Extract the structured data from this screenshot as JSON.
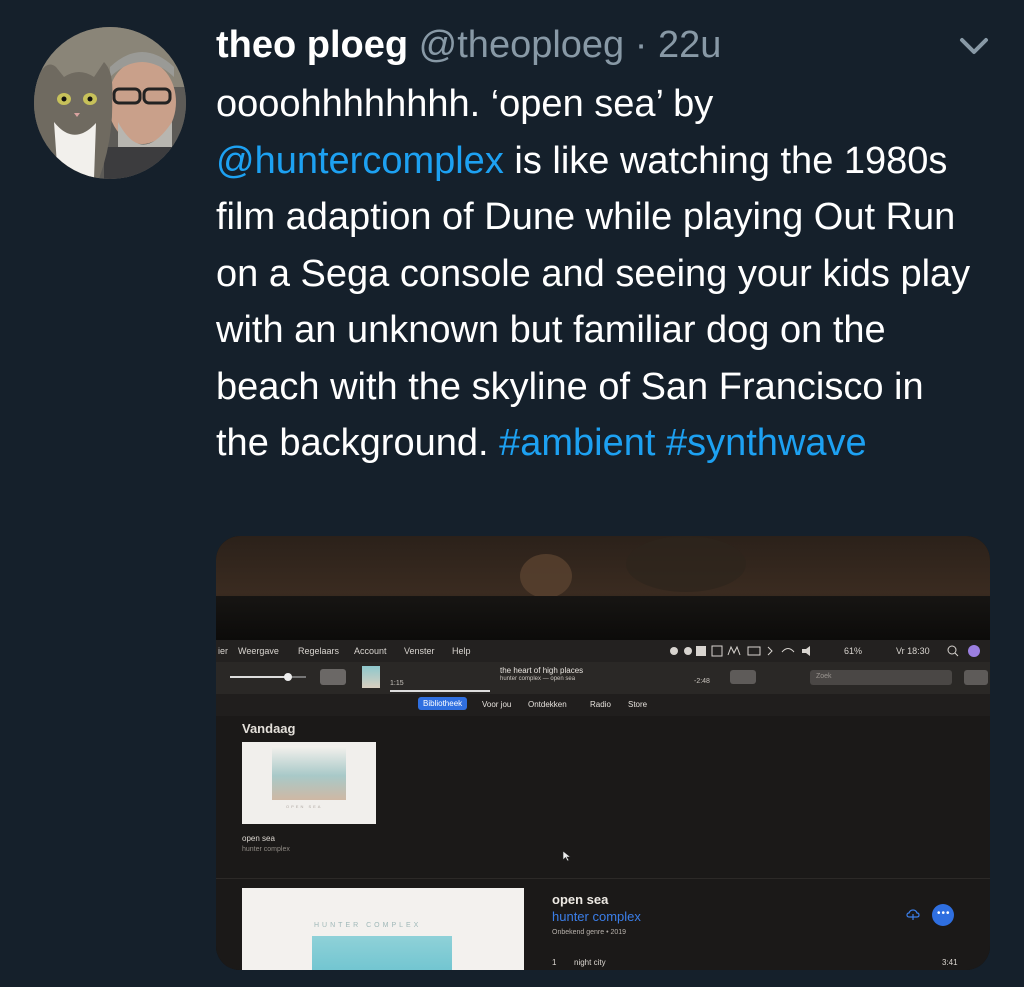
{
  "tweet": {
    "name": "theo ploeg",
    "handle": "@theoploeg",
    "separator": "·",
    "time": "22u",
    "text_1": "oooohhhhhhhh. ‘open sea’ by ",
    "mention": "@huntercomplex",
    "text_2": " is like watching the 1980s film adaption of Dune while playing Out Run on a Sega console and seeing your kids play with an unknown but familiar dog on the beach with the skyline of San Francisco in the background. ",
    "hashtag_1": "#ambient",
    "space": " ",
    "hashtag_2": "#synthwave"
  },
  "media": {
    "menu": [
      "ier",
      "Weergave",
      "Regelaars",
      "Account",
      "Venster",
      "Help"
    ],
    "status": {
      "battery": "61%",
      "clock": "Vr 18:30"
    },
    "now_playing": {
      "title": "the heart of high places",
      "subtitle": "hunter complex — open sea",
      "elapsed": "1:15",
      "remaining": "-2:48"
    },
    "search_placeholder": "Zoek",
    "tabs": [
      "Bibliotheek",
      "Voor jou",
      "Ontdekken",
      "Radio",
      "Store"
    ],
    "section_title": "Vandaag",
    "album_art_text": "OPEN SEA",
    "album_card": {
      "title": "open sea",
      "artist": "hunter complex"
    },
    "album_detail": {
      "title": "open sea",
      "artist": "hunter complex",
      "meta": "Onbekend genre • 2019",
      "cover_text": "HUNTER COMPLEX",
      "track_number": "1",
      "track_name": "night city",
      "track_time": "3:41"
    }
  },
  "colors": {
    "background": "#15202b",
    "link": "#1da1f2",
    "secondary": "#8899a6",
    "itunes_blue": "#2f6fe0"
  },
  "icons": [
    "avatar-photo",
    "chevron-down-icon"
  ]
}
